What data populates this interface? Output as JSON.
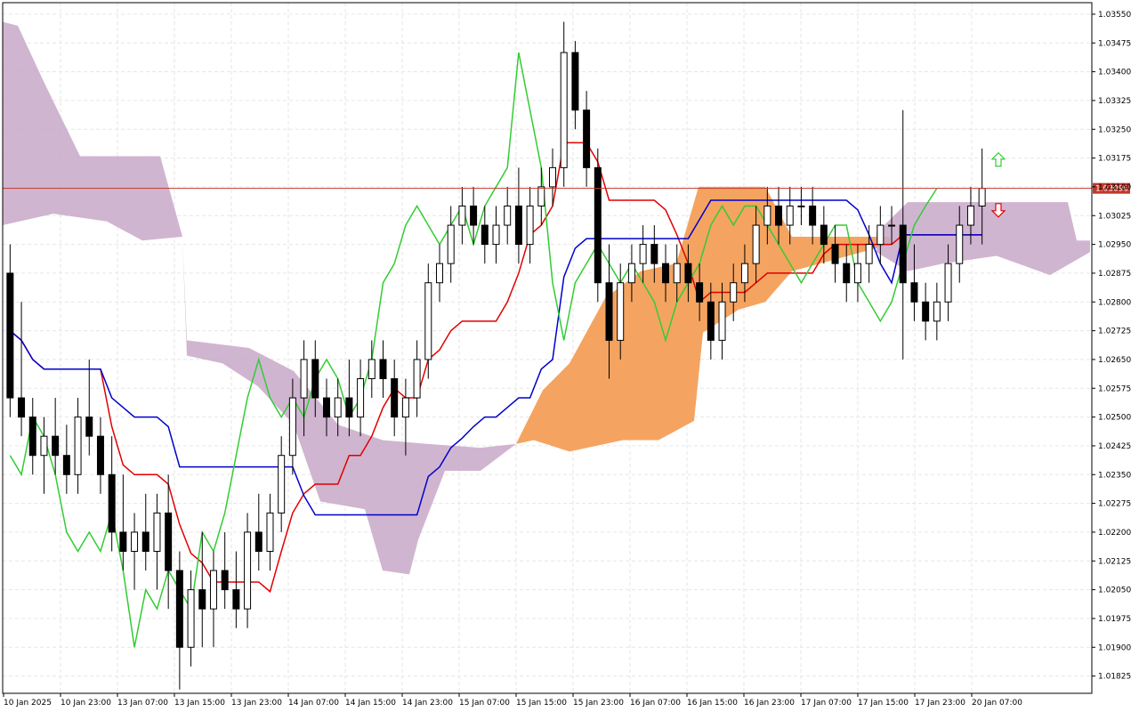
{
  "chart_data": {
    "type": "candlestick",
    "symbol_note": "",
    "current_price": 1.03096,
    "current_price_label": "1.03096",
    "y_range": [
      1.0178,
      1.0358
    ],
    "y_ticks": [
      "1.03550",
      "1.03475",
      "1.03400",
      "1.03325",
      "1.03250",
      "1.03175",
      "1.03100",
      "1.03025",
      "1.02950",
      "1.02875",
      "1.02800",
      "1.02725",
      "1.02650",
      "1.02575",
      "1.02500",
      "1.02425",
      "1.02350",
      "1.02275",
      "1.02200",
      "1.02125",
      "1.02050",
      "1.01975",
      "1.01900",
      "1.01825"
    ],
    "x_ticks": [
      "10 Jan 2025",
      "10 Jan 23:00",
      "13 Jan 07:00",
      "13 Jan 15:00",
      "13 Jan 23:00",
      "14 Jan 07:00",
      "14 Jan 15:00",
      "14 Jan 23:00",
      "15 Jan 07:00",
      "15 Jan 15:00",
      "15 Jan 23:00",
      "16 Jan 07:00",
      "16 Jan 15:00",
      "16 Jan 23:00",
      "17 Jan 07:00",
      "17 Jan 15:00",
      "17 Jan 23:00",
      "20 Jan 07:00"
    ],
    "grid": true,
    "colors": {
      "background": "#ffffff",
      "grid": "#e6e6e6",
      "axis": "#000000",
      "bull_body": "#ffffff",
      "bear_body": "#000000",
      "price_line": "#c0392b",
      "tenkan": "#e00000",
      "kijun": "#0000cc",
      "chikou": "#33cc33",
      "kumo_bear": "#c8a8c8",
      "kumo_bull": "#f4a460",
      "blue_body": "#2a6ab0",
      "arrow_up": "#33cc33",
      "arrow_down": "#e00000",
      "pink_line": "#ff66cc"
    },
    "candles": [
      [
        1.02875,
        1.0295,
        1.025,
        1.0255
      ],
      [
        1.0255,
        1.028,
        1.0245,
        1.025
      ],
      [
        1.025,
        1.0255,
        1.0235,
        1.024
      ],
      [
        1.024,
        1.025,
        1.023,
        1.0245
      ],
      [
        1.0245,
        1.0255,
        1.0235,
        1.024
      ],
      [
        1.024,
        1.0248,
        1.023,
        1.0235
      ],
      [
        1.0235,
        1.0255,
        1.023,
        1.025
      ],
      [
        1.025,
        1.0265,
        1.024,
        1.0245
      ],
      [
        1.0245,
        1.025,
        1.023,
        1.0235
      ],
      [
        1.0235,
        1.0245,
        1.0215,
        1.022
      ],
      [
        1.022,
        1.0235,
        1.021,
        1.0215
      ],
      [
        1.0215,
        1.0225,
        1.0205,
        1.022
      ],
      [
        1.022,
        1.023,
        1.021,
        1.0215
      ],
      [
        1.0215,
        1.023,
        1.0205,
        1.0225
      ],
      [
        1.0225,
        1.0235,
        1.02,
        1.021
      ],
      [
        1.021,
        1.0215,
        1.0179,
        1.019
      ],
      [
        1.019,
        1.021,
        1.0185,
        1.0205
      ],
      [
        1.0205,
        1.022,
        1.019,
        1.02
      ],
      [
        1.02,
        1.0215,
        1.019,
        1.021
      ],
      [
        1.021,
        1.022,
        1.02,
        1.0205
      ],
      [
        1.0205,
        1.0215,
        1.0195,
        1.02
      ],
      [
        1.02,
        1.0225,
        1.0195,
        1.022
      ],
      [
        1.022,
        1.023,
        1.021,
        1.0215
      ],
      [
        1.0215,
        1.023,
        1.021,
        1.0225
      ],
      [
        1.0225,
        1.0245,
        1.022,
        1.024
      ],
      [
        1.024,
        1.026,
        1.0235,
        1.0255
      ],
      [
        1.0255,
        1.027,
        1.0245,
        1.0265
      ],
      [
        1.0265,
        1.027,
        1.025,
        1.0255
      ],
      [
        1.0255,
        1.026,
        1.0245,
        1.025
      ],
      [
        1.025,
        1.026,
        1.0245,
        1.0255
      ],
      [
        1.0255,
        1.0265,
        1.0245,
        1.025
      ],
      [
        1.025,
        1.0265,
        1.0245,
        1.026
      ],
      [
        1.026,
        1.027,
        1.0255,
        1.0265
      ],
      [
        1.0265,
        1.027,
        1.0255,
        1.026
      ],
      [
        1.026,
        1.0265,
        1.0245,
        1.025
      ],
      [
        1.025,
        1.026,
        1.024,
        1.0255
      ],
      [
        1.0255,
        1.027,
        1.025,
        1.0265
      ],
      [
        1.0265,
        1.029,
        1.026,
        1.0285
      ],
      [
        1.0285,
        1.0295,
        1.028,
        1.029
      ],
      [
        1.029,
        1.0305,
        1.0285,
        1.03
      ],
      [
        1.03,
        1.031,
        1.0295,
        1.0305
      ],
      [
        1.0305,
        1.031,
        1.0295,
        1.03
      ],
      [
        1.03,
        1.0305,
        1.029,
        1.0295
      ],
      [
        1.0295,
        1.0305,
        1.029,
        1.03
      ],
      [
        1.03,
        1.031,
        1.0295,
        1.0305
      ],
      [
        1.0305,
        1.0315,
        1.029,
        1.0295
      ],
      [
        1.0295,
        1.031,
        1.029,
        1.0305
      ],
      [
        1.0305,
        1.0315,
        1.03,
        1.031
      ],
      [
        1.031,
        1.032,
        1.0305,
        1.0315
      ],
      [
        1.0315,
        1.0353,
        1.031,
        1.0345
      ],
      [
        1.0345,
        1.0348,
        1.0325,
        1.033
      ],
      [
        1.033,
        1.0335,
        1.031,
        1.0315
      ],
      [
        1.0315,
        1.032,
        1.028,
        1.0285
      ],
      [
        1.0285,
        1.0295,
        1.026,
        1.027
      ],
      [
        1.027,
        1.029,
        1.0265,
        1.0285
      ],
      [
        1.0285,
        1.0295,
        1.028,
        1.029
      ],
      [
        1.029,
        1.03,
        1.0285,
        1.0295
      ],
      [
        1.0295,
        1.03,
        1.0285,
        1.029
      ],
      [
        1.029,
        1.0295,
        1.028,
        1.0285
      ],
      [
        1.0285,
        1.0295,
        1.028,
        1.029
      ],
      [
        1.029,
        1.0295,
        1.028,
        1.0285
      ],
      [
        1.0285,
        1.029,
        1.0275,
        1.028
      ],
      [
        1.028,
        1.0285,
        1.0265,
        1.027
      ],
      [
        1.027,
        1.0285,
        1.0265,
        1.028
      ],
      [
        1.028,
        1.029,
        1.0275,
        1.0285
      ],
      [
        1.0285,
        1.0295,
        1.028,
        1.029
      ],
      [
        1.029,
        1.0305,
        1.0285,
        1.03
      ],
      [
        1.03,
        1.031,
        1.0295,
        1.0305
      ],
      [
        1.0305,
        1.031,
        1.0295,
        1.03
      ],
      [
        1.03,
        1.031,
        1.0295,
        1.0305
      ],
      [
        1.0305,
        1.031,
        1.03,
        1.0305
      ],
      [
        1.0305,
        1.031,
        1.0295,
        1.03
      ],
      [
        1.03,
        1.0305,
        1.029,
        1.0295
      ],
      [
        1.0295,
        1.03,
        1.0285,
        1.029
      ],
      [
        1.029,
        1.0295,
        1.028,
        1.0285
      ],
      [
        1.0285,
        1.0295,
        1.028,
        1.029
      ],
      [
        1.029,
        1.03,
        1.0285,
        1.0295
      ],
      [
        1.0295,
        1.0305,
        1.029,
        1.03
      ],
      [
        1.03,
        1.0305,
        1.0295,
        1.03
      ],
      [
        1.03,
        1.033,
        1.0265,
        1.0285
      ],
      [
        1.0285,
        1.0295,
        1.0275,
        1.028
      ],
      [
        1.028,
        1.0285,
        1.027,
        1.0275
      ],
      [
        1.0275,
        1.0285,
        1.027,
        1.028
      ],
      [
        1.028,
        1.0295,
        1.0275,
        1.029
      ],
      [
        1.029,
        1.0305,
        1.0285,
        1.03
      ],
      [
        1.03,
        1.031,
        1.0295,
        1.0305
      ],
      [
        1.0305,
        1.032,
        1.0295,
        1.03096
      ]
    ]
  }
}
